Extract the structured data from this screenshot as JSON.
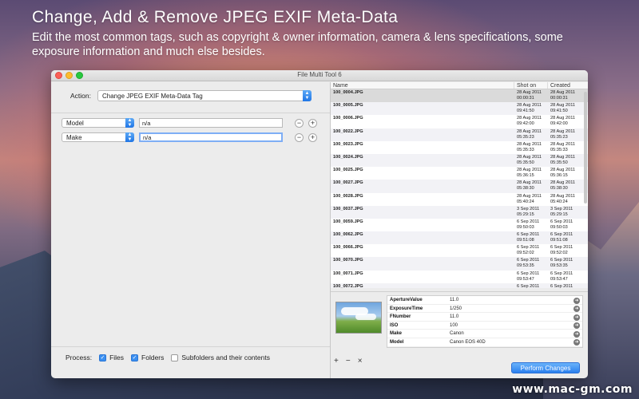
{
  "headline": "Change, Add & Remove JPEG EXIF Meta-Data",
  "subline": "Edit the most common tags, such as copyright & owner information, camera & lens specifications, some exposure information and much else besides.",
  "window": {
    "title": "File Multi Tool 6"
  },
  "action": {
    "label": "Action:",
    "value": "Change JPEG EXIF Meta-Data Tag"
  },
  "tags": [
    {
      "tag": "Model",
      "value": "n/a",
      "remove": "−",
      "add": "+"
    },
    {
      "tag": "Make",
      "value": "n/a",
      "remove": "−",
      "add": "+"
    }
  ],
  "process": {
    "label": "Process:",
    "files": {
      "label": "Files",
      "checked": true
    },
    "folders": {
      "label": "Folders",
      "checked": true
    },
    "subfolders": {
      "label": "Subfolders and their contents",
      "checked": false
    }
  },
  "table": {
    "columns": [
      "Name",
      "Shot on",
      "Created"
    ],
    "rows": [
      {
        "name": "100_0004.JPG",
        "shot_date": "28 Aug 2011",
        "shot_time": "00:00:31",
        "created_date": "28 Aug 2011",
        "created_time": "00:00:31"
      },
      {
        "name": "100_0005.JPG",
        "shot_date": "28 Aug 2011",
        "shot_time": "09:41:50",
        "created_date": "28 Aug 2011",
        "created_time": "09:41:50"
      },
      {
        "name": "100_0006.JPG",
        "shot_date": "28 Aug 2011",
        "shot_time": "09:42:00",
        "created_date": "28 Aug 2011",
        "created_time": "09:42:00"
      },
      {
        "name": "100_0022.JPG",
        "shot_date": "28 Aug 2011",
        "shot_time": "05:35:23",
        "created_date": "28 Aug 2011",
        "created_time": "05:35:23"
      },
      {
        "name": "100_0023.JPG",
        "shot_date": "28 Aug 2011",
        "shot_time": "05:35:33",
        "created_date": "28 Aug 2011",
        "created_time": "05:35:33"
      },
      {
        "name": "100_0024.JPG",
        "shot_date": "28 Aug 2011",
        "shot_time": "05:35:50",
        "created_date": "28 Aug 2011",
        "created_time": "05:35:50"
      },
      {
        "name": "100_0025.JPG",
        "shot_date": "28 Aug 2011",
        "shot_time": "05:36:15",
        "created_date": "28 Aug 2011",
        "created_time": "05:36:15"
      },
      {
        "name": "100_0027.JPG",
        "shot_date": "28 Aug 2011",
        "shot_time": "05:38:30",
        "created_date": "28 Aug 2011",
        "created_time": "05:38:30"
      },
      {
        "name": "100_0028.JPG",
        "shot_date": "28 Aug 2011",
        "shot_time": "05:40:24",
        "created_date": "28 Aug 2011",
        "created_time": "05:40:24"
      },
      {
        "name": "100_0037.JPG",
        "shot_date": "3 Sep 2011",
        "shot_time": "05:29:15",
        "created_date": "3 Sep 2011",
        "created_time": "05:29:15"
      },
      {
        "name": "100_0059.JPG",
        "shot_date": "6 Sep 2011",
        "shot_time": "09:50:03",
        "created_date": "6 Sep 2011",
        "created_time": "09:50:03"
      },
      {
        "name": "100_0062.JPG",
        "shot_date": "6 Sep 2011",
        "shot_time": "09:51:08",
        "created_date": "6 Sep 2011",
        "created_time": "09:51:08"
      },
      {
        "name": "100_0066.JPG",
        "shot_date": "6 Sep 2011",
        "shot_time": "09:52:02",
        "created_date": "6 Sep 2011",
        "created_time": "09:52:02"
      },
      {
        "name": "100_0070.JPG",
        "shot_date": "6 Sep 2011",
        "shot_time": "09:53:35",
        "created_date": "6 Sep 2011",
        "created_time": "09:53:35"
      },
      {
        "name": "100_0071.JPG",
        "shot_date": "6 Sep 2011",
        "shot_time": "09:53:47",
        "created_date": "6 Sep 2011",
        "created_time": "09:53:47"
      },
      {
        "name": "100_0072.JPG",
        "shot_date": "6 Sep 2011",
        "shot_time": "",
        "created_date": "6 Sep 2011",
        "created_time": ""
      }
    ]
  },
  "properties": [
    {
      "key": "ApertureValue",
      "value": "11.0"
    },
    {
      "key": "ExposureTime",
      "value": "1/250"
    },
    {
      "key": "FNumber",
      "value": "11.0"
    },
    {
      "key": "ISO",
      "value": "100"
    },
    {
      "key": "Make",
      "value": "Canon"
    },
    {
      "key": "Model",
      "value": "Canon EOS 40D"
    }
  ],
  "tools": {
    "add": "+",
    "remove": "−",
    "clear": "×"
  },
  "perform_label": "Perform Changes",
  "watermark": "www.mac-gm.com"
}
